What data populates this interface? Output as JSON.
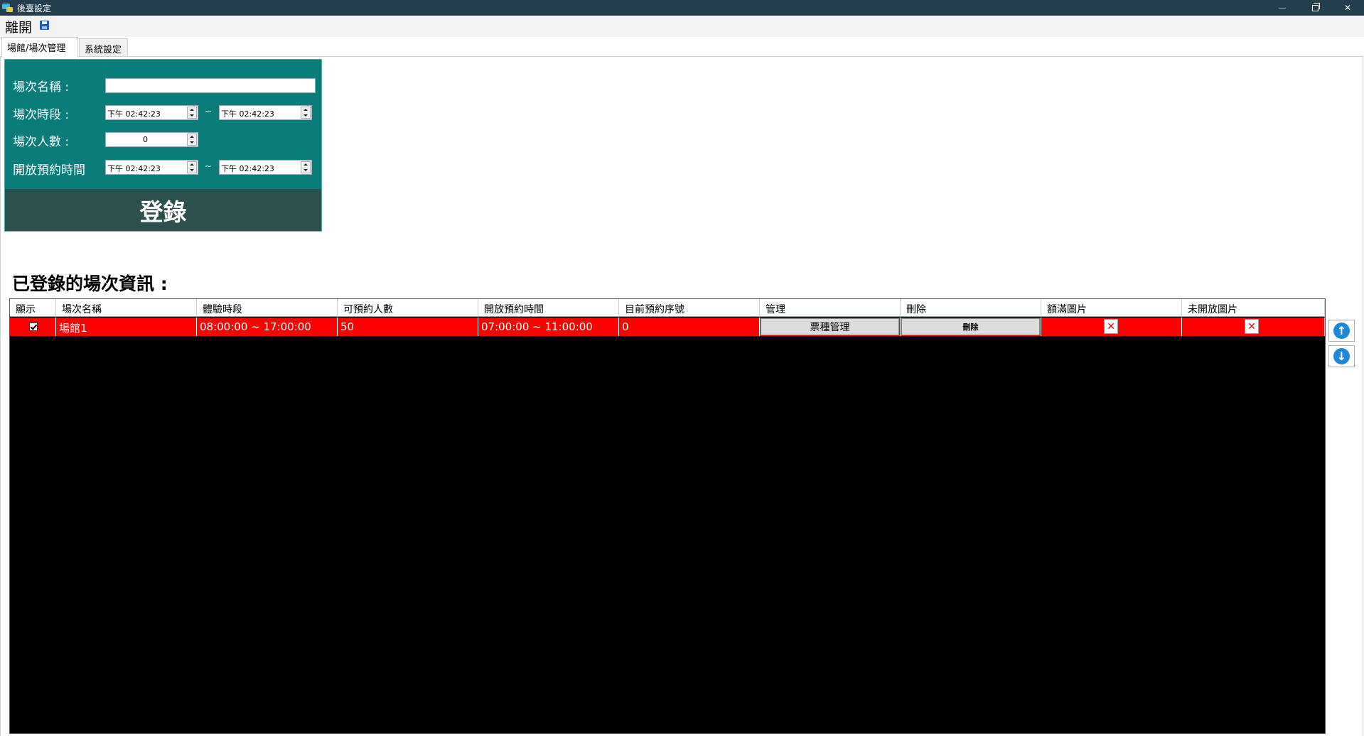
{
  "window": {
    "title": "後臺設定"
  },
  "menu": {
    "exit_label": "離開"
  },
  "tabs": [
    {
      "label": "場館/場次管理",
      "active": true
    },
    {
      "label": "系統設定",
      "active": false
    }
  ],
  "form": {
    "name_label": "場次名稱 :",
    "name_value": "",
    "period_label": "場次時段 :",
    "period_start": "下午 02:42:23",
    "period_end": "下午 02:42:23",
    "capacity_label": "場次人數 :",
    "capacity_value": "0",
    "booking_label": "開放預約時間",
    "booking_start": "下午 02:42:23",
    "booking_end": "下午 02:42:23",
    "separator": "~",
    "register_label": "登錄",
    "panel_color": "#0a7c79"
  },
  "section_title": "已登錄的場次資訊 :",
  "grid": {
    "columns": [
      "顯示",
      "場次名稱",
      "體驗時段",
      "可預約人數",
      "開放預約時間",
      "目前預約序號",
      "管理",
      "刪除",
      "額滿圖片",
      "未開放圖片"
    ],
    "rows": [
      {
        "show": true,
        "name": "場館1",
        "time": "08:00:00 ~ 17:00:00",
        "capacity": "50",
        "booking_time": "07:00:00 ~ 11:00:00",
        "current_no": "0",
        "manage_label": "票種管理",
        "delete_label": "刪除",
        "full_image": "✕",
        "closed_image": "✕",
        "row_color": "#ff0000"
      }
    ]
  },
  "move_buttons": {
    "up_icon": "↑",
    "down_icon": "↓"
  }
}
